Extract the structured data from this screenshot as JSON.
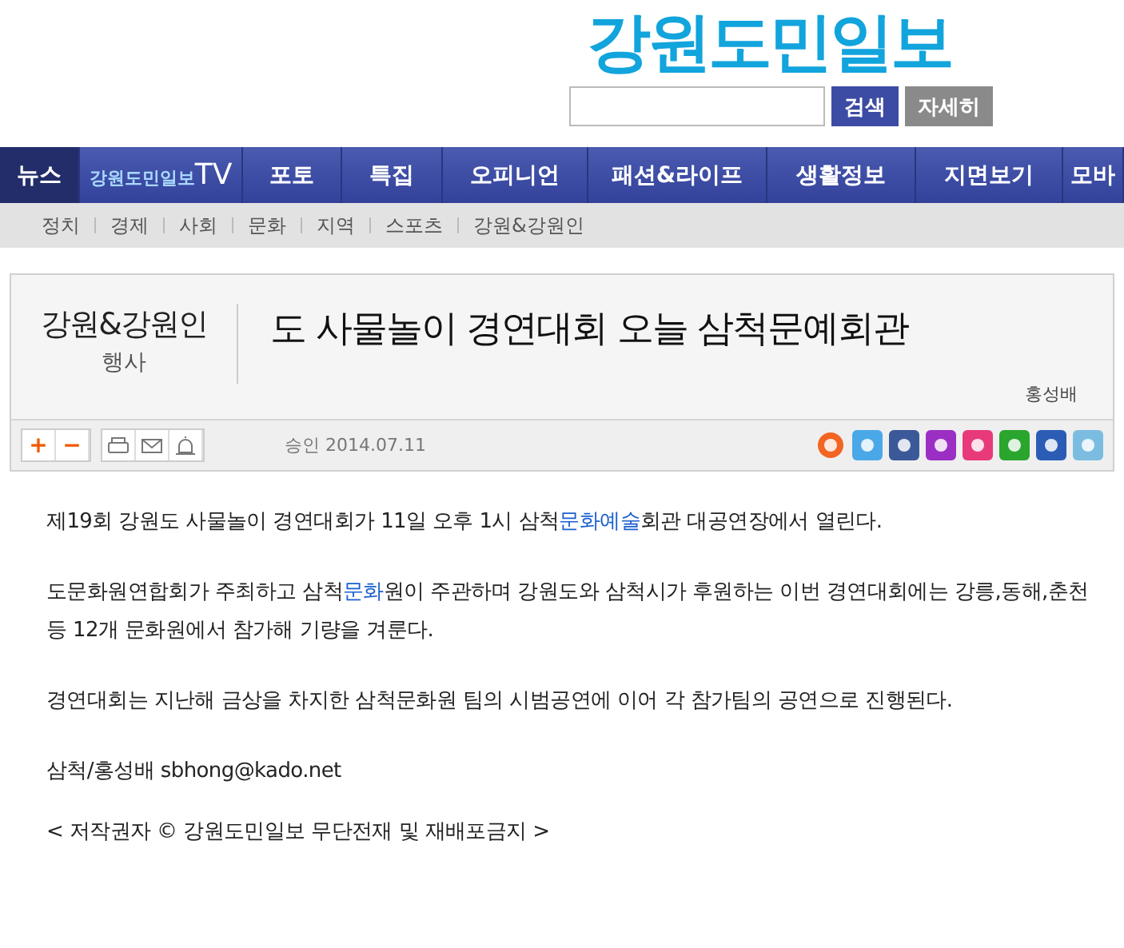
{
  "logo": "강원도민일보",
  "search": {
    "search_button": "검색",
    "detail_button": "자세히"
  },
  "nav": [
    {
      "kind": "text",
      "label": "뉴스",
      "selected": true
    },
    {
      "kind": "tv",
      "label": "강원도민일보",
      "suffix": "TV",
      "selected": false
    },
    {
      "kind": "text",
      "label": "포토",
      "selected": false
    },
    {
      "kind": "text",
      "label": "특집",
      "selected": false
    },
    {
      "kind": "text",
      "label": "오피니언",
      "selected": false
    },
    {
      "kind": "text",
      "label": "패션&라이프",
      "selected": false
    },
    {
      "kind": "text",
      "label": "생활정보",
      "selected": false
    },
    {
      "kind": "text",
      "label": "지면보기",
      "selected": false
    },
    {
      "kind": "text",
      "label": "모바",
      "selected": false
    }
  ],
  "subnav": [
    "정치",
    "경제",
    "사회",
    "문화",
    "지역",
    "스포츠",
    "강원&강원인"
  ],
  "article": {
    "section": "강원&강원인",
    "category": "행사",
    "title": "도 사물놀이 경연대회 오늘 삼척문예회관",
    "author": "홍성배",
    "approved": "승인 2014.07.11",
    "tools": [
      "+",
      "−"
    ],
    "paragraphs": [
      [
        {
          "kind": "text",
          "text": "제19회 강원도 사물놀이 경연대회가 11일 오후 1시 삼척"
        },
        {
          "kind": "link",
          "text": "문화예술"
        },
        {
          "kind": "text",
          "text": "회관 대공연장에서 열린다."
        }
      ],
      [
        {
          "kind": "text",
          "text": "도문화원연합회가 주최하고 삼척"
        },
        {
          "kind": "link",
          "text": "문화"
        },
        {
          "kind": "text",
          "text": "원이 주관하며 강원도와 삼척시가 후원하는 이번 경연대회에는 강릉,동해,춘천 등 12개 문화원에서 참가해 기량을 겨룬다."
        }
      ],
      [
        {
          "kind": "text",
          "text": "경연대회는 지난해 금상을 차지한 삼척문화원 팀의 시범공연에 이어 각 참가팀의 공연으로 진행된다."
        }
      ],
      [
        {
          "kind": "text",
          "text": "삼척/홍성배 sbhong@kado.net"
        }
      ]
    ],
    "copyright": "< 저작권자 © 강원도민일보 무단전재 및 재배포금지 >"
  }
}
